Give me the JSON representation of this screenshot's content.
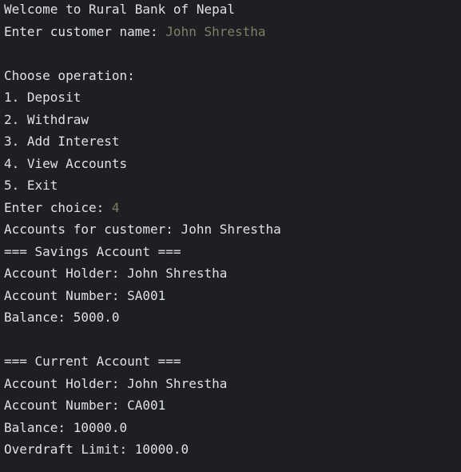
{
  "console": {
    "colors": {
      "background": "#1e1f22",
      "output_text": "#dfe1e5",
      "user_input": "#7b8068"
    },
    "welcome": "Welcome to Rural Bank of Nepal",
    "name_prompt": "Enter customer name: ",
    "name_input": "John Shrestha",
    "menu_title": "Choose operation:",
    "menu_items": [
      "1. Deposit",
      "2. Withdraw",
      "3. Add Interest",
      "4. View Accounts",
      "5. Exit"
    ],
    "choice_prompt": "Enter choice: ",
    "choice_input": "4",
    "accounts_header": "Accounts for customer: John Shrestha",
    "savings": {
      "title": "=== Savings Account ===",
      "holder": "Account Holder: John Shrestha",
      "number": "Account Number: SA001",
      "balance": "Balance: 5000.0"
    },
    "current": {
      "title": "=== Current Account ===",
      "holder": "Account Holder: John Shrestha",
      "number": "Account Number: CA001",
      "balance": "Balance: 10000.0",
      "overdraft": "Overdraft Limit: 10000.0"
    }
  }
}
